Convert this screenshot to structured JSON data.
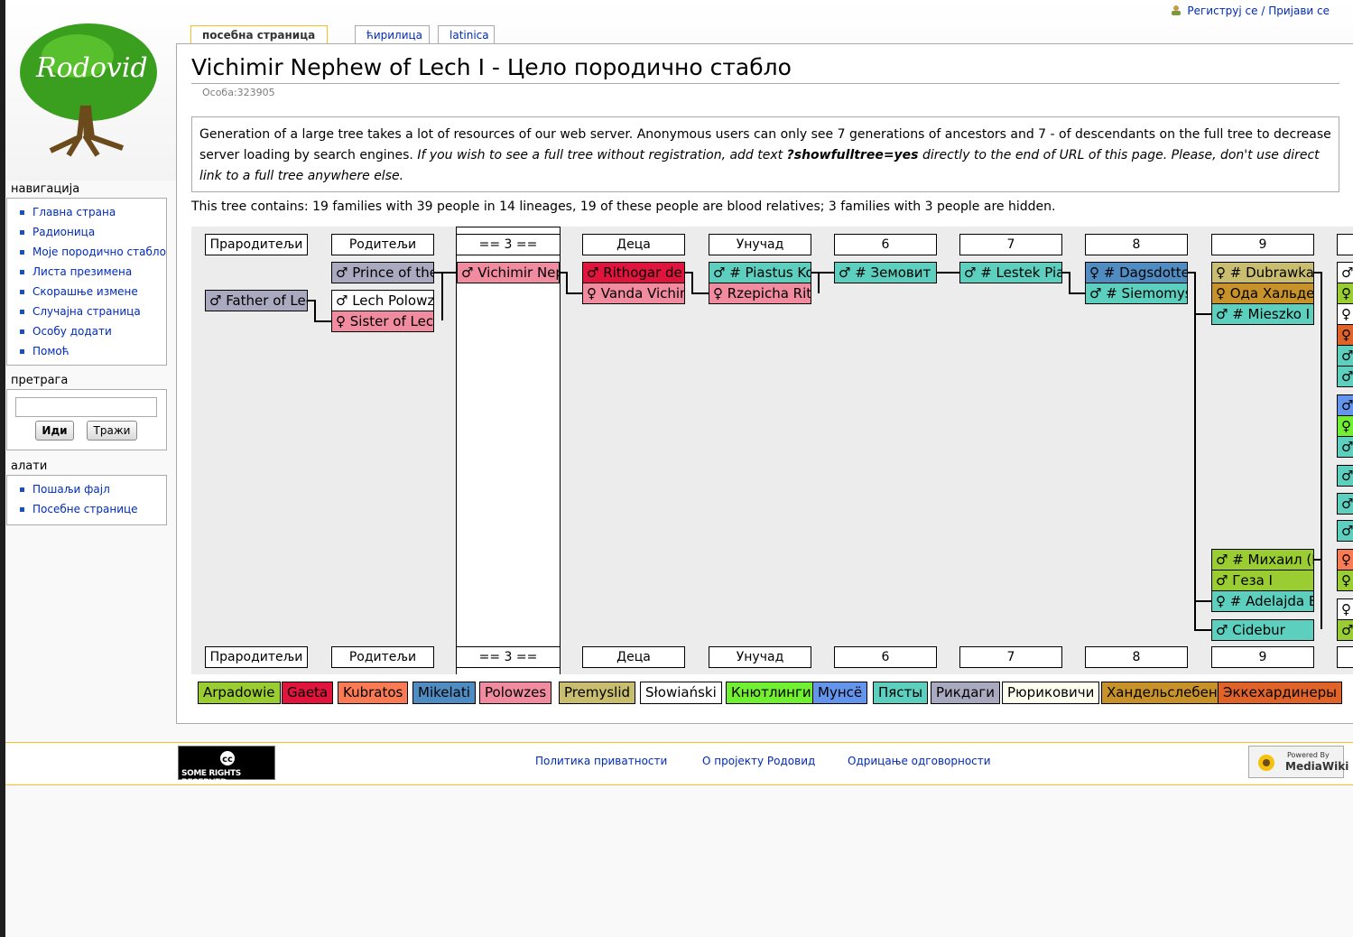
{
  "personal": {
    "login": "Региструj се / Пријави се"
  },
  "logo": {
    "text": "Rodovid"
  },
  "tabs": [
    {
      "label": "посебна страница",
      "selected": true
    },
    {
      "label": "ћирилица",
      "selected": false
    },
    {
      "label": "latinica",
      "selected": false
    }
  ],
  "page": {
    "title": "Vichimir Nephew of Lech I - Цело породично стабло",
    "sub": "Особа:323905",
    "notice": {
      "part1": "Generation of a large tree takes a lot of resources of our web server. Anonymous users can only see 7 generations of ancestors and 7 - of descendants on the full tree to decrease server loading by search engines. ",
      "part2": "If you wish to see a full tree without registration, add text ",
      "code": "?showfulltree=yes",
      "part3": " directly to the end of URL of this page. Please, don't use direct link to a full tree anywhere else."
    },
    "summary": "This tree contains: 19 families with 39 people in 14 lineages, 19 of these people are blood relatives; 3 families with 3 people are hidden."
  },
  "sidebar": {
    "nav_title": "навигација",
    "nav_items": [
      "Главна страна",
      "Радионица",
      "Моје породично стабло",
      "Листа презимена",
      "Скорашње измене",
      "Случајна страница",
      "Особу додати",
      "Помоћ"
    ],
    "search_title": "претрага",
    "search_go": "Иди",
    "search_find": "Тражи",
    "tools_title": "алати",
    "tools_items": [
      "Пошаљи фајл",
      "Посебне странице"
    ]
  },
  "tree": {
    "headers": [
      "Прародитељи",
      "Родитељи",
      "== 3 ==",
      "Деца",
      "Унучад",
      "6",
      "7",
      "8",
      "9"
    ],
    "people": {
      "father_of_lech": "♂ Father of Lech I",
      "prince": "♂ Prince of the Polans",
      "lech": "♂ Lech Polowzes",
      "sister": "♀ Sister of Lech",
      "vichimir": "♂ Vichimir Nephew",
      "rithogar": "♂ Rithogar de Gaeta",
      "vanda": "♀ Vanda Vichimir",
      "piastus": "♂ # Piastus Kolodziej",
      "rzepicha": "♀ Rzepicha Rithogar",
      "zemovit": "♂ # Земовит Пяст",
      "lestek": "♂ # Lestek Piast",
      "dagsdotter": "♀ # Dagsdotter",
      "siemomysl": "♂ # Siemomysl",
      "dubrawka": "♀ # Dubrawka von",
      "oda": "♀ Ода Хальденслебен",
      "mieszko": "♂ # Mieszko I von",
      "mihail": "♂ # Михаил (Мику",
      "geza": "♂ Геза I",
      "adelajda": "♀ # Adelajda Bialoknegini",
      "cidebur": "♂ Cidebur"
    },
    "colors": {
      "slowianski": "#ffffff",
      "polowzes": "#f08ba0",
      "gaeta": "#e0143c",
      "pyast": "#5ccfbf",
      "rikdagi": "#a9a9bf",
      "handelsleben": "#c8922a",
      "arpadowie": "#9acd32",
      "premyslid": "#c9bd6f",
      "mikelati": "#4f8cc2",
      "kubratos": "#fa7a54",
      "knutlingi": "#70f030",
      "munse": "#6495ed",
      "ryurikovichi": "#fffff0",
      "ekkehard": "#e0642a"
    }
  },
  "legend": [
    "Arpadowie",
    "Gaeta",
    "Kubratos",
    "Mikelati",
    "Polowzes",
    "Premyslid",
    "Słowiański",
    "Кнютлинги",
    "Мунсё",
    "Пясты",
    "Рикдаги",
    "Рюриковичи",
    "Хандельслебен",
    "Эккехардинеры"
  ],
  "footer": {
    "cc": "SOME RIGHTS RESERVED",
    "links": [
      "Политика приватности",
      "О пројекту Родовид",
      "Одрицање одговорности"
    ],
    "mw_powered": "Powered By",
    "mw_name": "MediaWiki"
  }
}
